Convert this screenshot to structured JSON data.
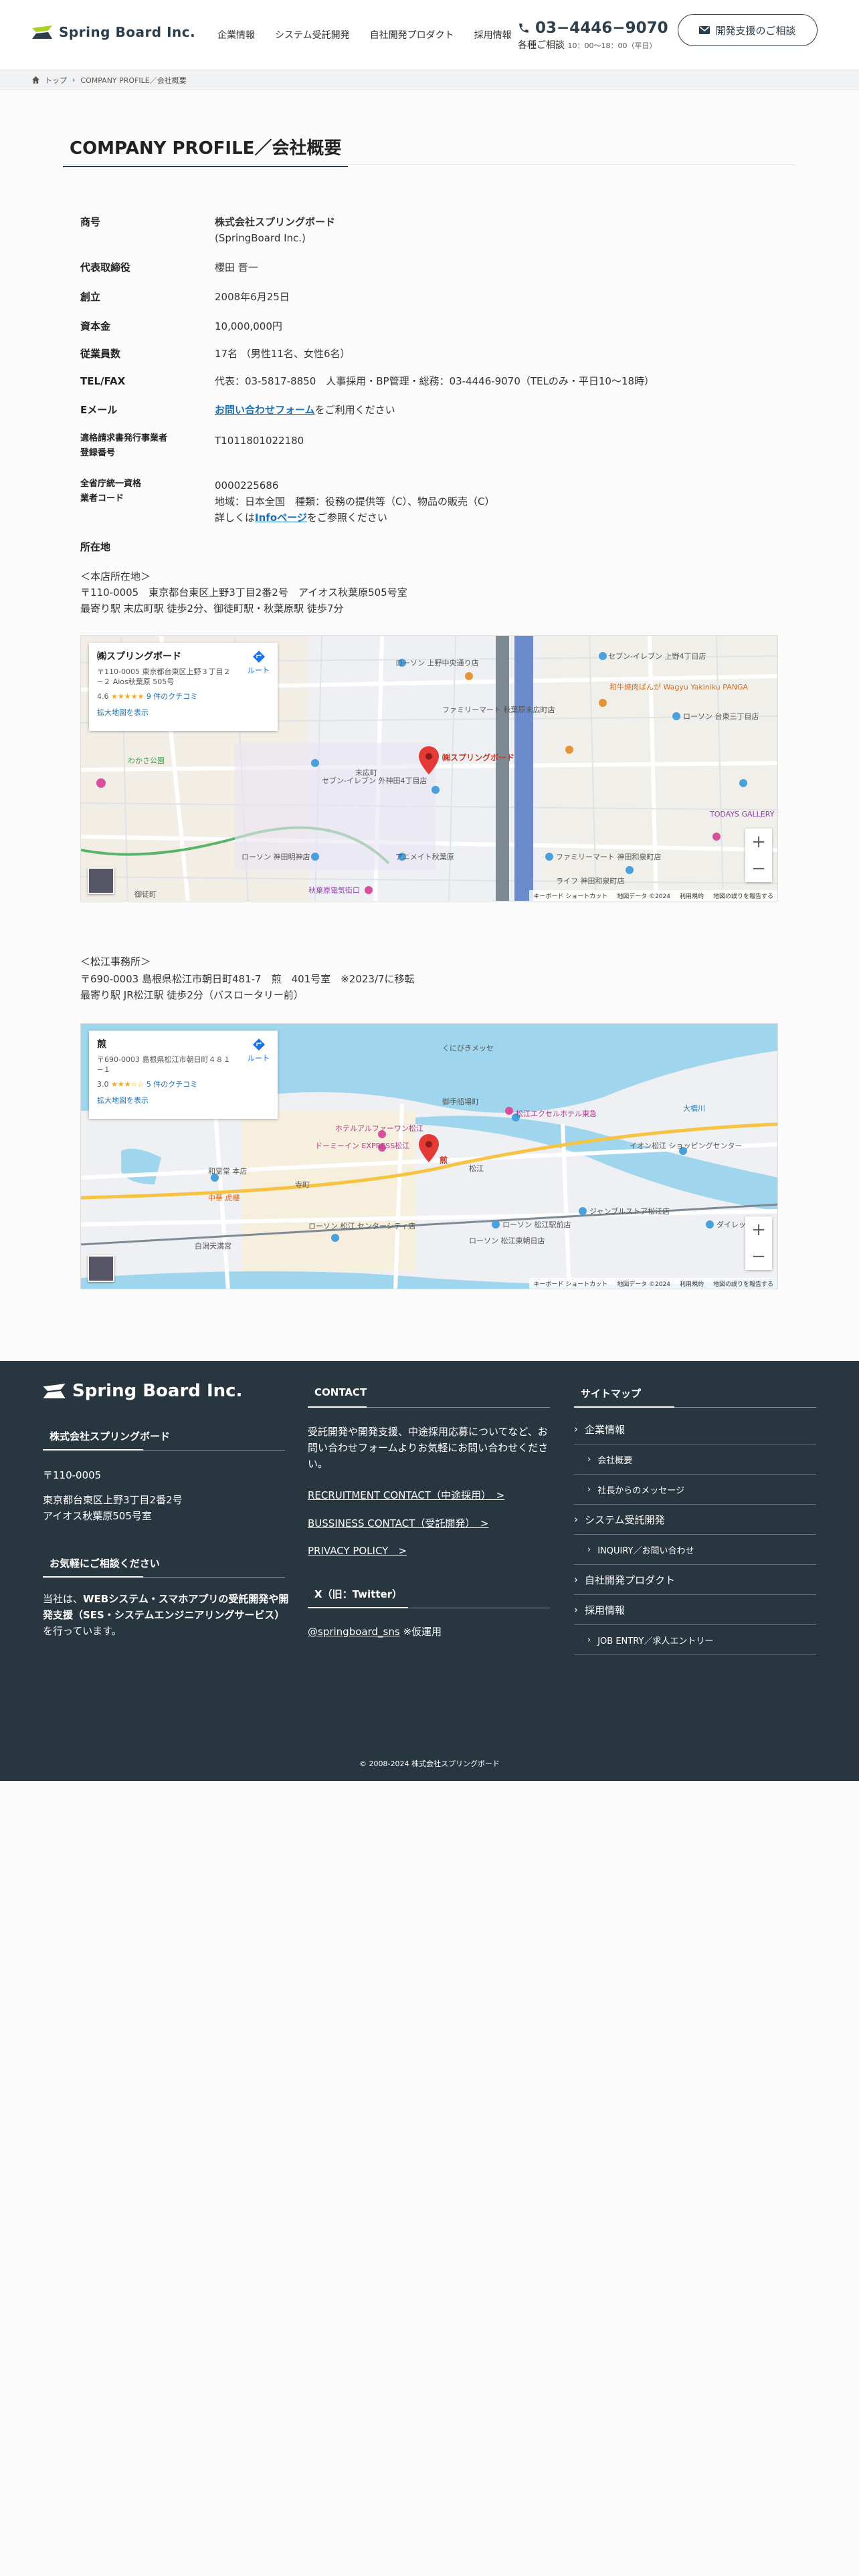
{
  "header": {
    "logo_text": "Spring Board Inc.",
    "nav": [
      "企業情報",
      "システム受託開発",
      "自社開発プロダクト",
      "採用情報"
    ],
    "phone": "03−4446−9070",
    "phone_sub": "各種ご相談",
    "phone_hours": "10：00〜18：00（平日）",
    "cta": "開発支援のご相談"
  },
  "breadcrumb": {
    "home": "トップ",
    "current": "COMPANY PROFILE／会社概要"
  },
  "page_title": "COMPANY PROFILE／会社概要",
  "profile": {
    "company_label": "商号",
    "company_name": "株式会社スプリングボード",
    "company_name_en": "(SpringBoard Inc.)",
    "ceo_label": "代表取締役",
    "ceo": "櫻田 晋一",
    "founded_label": "創立",
    "founded": "2008年6月25日",
    "capital_label": "資本金",
    "capital": "10,000,000円",
    "employees_label": "従業員数",
    "employees": "17名 （男性11名、女性6名）",
    "tel_label": "TEL/FAX",
    "tel": "代表：03-5817-8850　人事採用・BP管理・総務：03-4446-9070（TELのみ・平日10〜18時）",
    "email_label": "Eメール",
    "email_link": "お問い合わせフォーム",
    "email_suffix": "をご利用ください",
    "invoice_label1": "適格請求書発行事業者",
    "invoice_label2": "登録番号",
    "invoice": "T1011801022180",
    "license_label1": "全省庁統一資格",
    "license_label2": "業者コード",
    "license_code": "0000225686",
    "license_detail": "地域：日本全国　種類：役務の提供等（C）、物品の販売（C）",
    "license_note_prefix": "詳しくは",
    "license_note_link": "Infoページ",
    "license_note_suffix": "をご参照ください",
    "location_label": "所在地",
    "head_office_title": "＜本店所在地＞",
    "head_office_address": "〒110-0005　東京都台東区上野3丁目2番2号　アイオス秋葉原505号室",
    "head_office_station": "最寄り駅 末広町駅 徒歩2分、御徒町駅・秋葉原駅 徒歩7分",
    "matsue_title": "＜松江事務所＞",
    "matsue_address": "〒690-0003 島根県松江市朝日町481-7　煎　401号室　※2023/7に移転",
    "matsue_station": "最寄り駅 JR松江駅 徒歩2分（バスロータリー前）"
  },
  "map1": {
    "name": "㈱スプリングボード",
    "address": "〒110-0005 東京都台東区上野３丁目２−２ Aios秋葉原 505号",
    "rating": "4.6",
    "stars": "★★★★★",
    "reviews": "9 件のクチコミ",
    "large_map": "拡大地図を表示",
    "route": "ルート",
    "pin_label": "㈱スプリングボード",
    "footer": [
      "キーボード ショートカット",
      "地図データ ©2024",
      "利用規約",
      "地図の誤りを報告する"
    ],
    "places": [
      "ローソン 上野中央通り店",
      "セブン-イレブン 上野4丁目店",
      "和牛焼肉ぱんが Wagyu Yakiniku PANGA",
      "ローソン 台東三丁目店",
      "ファミリーマート 秋葉原末広町店",
      "セブン-イレブン 外神田4丁目店",
      "TODAYS GALLERY STUDIO.",
      "ローソン 神田明神店",
      "アニメイト秋葉原",
      "秋葉原電気街口",
      "ファミリーマート 神田和泉町店",
      "ライフ 神田和泉町店",
      "わかさ公園",
      "末広町",
      "御徒町"
    ]
  },
  "map2": {
    "name": "煎",
    "address": "〒690-0003 島根県松江市朝日町４８１−１",
    "rating": "3.0",
    "stars": "★★★☆☆",
    "reviews": "5 件のクチコミ",
    "large_map": "拡大地図を表示",
    "route": "ルート",
    "pin_label": "煎",
    "footer": [
      "キーボード ショートカット",
      "地図データ ©2024",
      "利用規約",
      "地図の誤りを報告する"
    ],
    "places": [
      "大橋川",
      "松江エクセルホテル東急",
      "ホテルアルファーワン松江",
      "ドーミーイン EXPRESS松江",
      "イオン松江 ショッピングセンター",
      "ジャンブルストア松江店",
      "ダイレックス",
      "ローソン 松江駅前店",
      "ローソン 松江 センターシティ店",
      "和霊堂 本店",
      "中華 虎樓",
      "御手船場町",
      "松江",
      "寺町",
      "白潟天満宮",
      "ローソン 松江東朝日店",
      "くにびきメッセ"
    ]
  },
  "footer": {
    "logo_text": "Spring Board Inc.",
    "company_heading": "株式会社スプリングボード",
    "zip": "〒110-0005",
    "address1": "東京都台東区上野3丁目2番2号",
    "address2": "アイオス秋葉原505号室",
    "consult_heading": "お気軽にご相談ください",
    "consult_bold": "WEBシステム・スマホアプリの受託開発や開発支援（SES・システムエンジニアリングサービス）",
    "consult_prefix": "当社は、",
    "consult_suffix": "を行っています。",
    "contact_heading": "CONTACT",
    "contact_text": "受託開発や開発支援、中途採用応募についてなど、お問い合わせフォームよりお気軽にお問い合わせください。",
    "contact_links": [
      "RECRUITMENT CONTACT（中途採用）　>",
      "BUSSINESS CONTACT（受託開発）　>",
      "PRIVACY POLICY　>"
    ],
    "x_heading": "X（旧：Twitter）",
    "x_handle": "@springboard_sns",
    "x_note": "※仮運用",
    "sitemap_heading": "サイトマップ",
    "sitemap": [
      {
        "label": "企業情報",
        "sub": false
      },
      {
        "label": "会社概要",
        "sub": true
      },
      {
        "label": "社長からのメッセージ",
        "sub": true
      },
      {
        "label": "システム受託開発",
        "sub": false
      },
      {
        "label": "INQUIRY／お問い合わせ",
        "sub": true
      },
      {
        "label": "自社開発プロダクト",
        "sub": false
      },
      {
        "label": "採用情報",
        "sub": false
      },
      {
        "label": "JOB ENTRY／求人エントリー",
        "sub": true
      }
    ],
    "copyright": "© 2008-2024 株式会社スプリングボード"
  },
  "colors": {
    "brand": "#2c3e4c",
    "accent": "#a8d12a",
    "link": "#1a6fb5",
    "footer_bg": "#283640"
  }
}
